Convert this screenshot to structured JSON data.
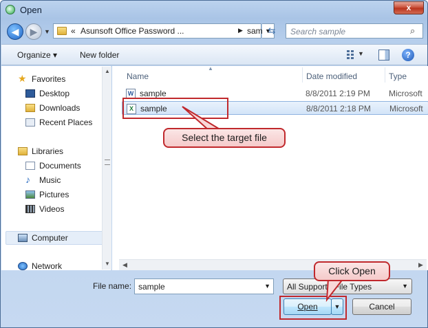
{
  "window": {
    "title": "Open",
    "close_glyph": "x"
  },
  "nav": {
    "back_glyph": "◀",
    "forward_glyph": "▶",
    "breadcrumb_chevron": "«",
    "breadcrumb": [
      "Asunsoft Office Password ...",
      "sample"
    ],
    "search_placeholder": "Search sample"
  },
  "toolbar": {
    "organize": "Organize ▾",
    "new_folder": "New folder",
    "help_glyph": "?"
  },
  "sidebar": {
    "items": [
      {
        "label": "Favorites",
        "icon": "star-icon"
      },
      {
        "label": "Desktop",
        "icon": "desktop-icon"
      },
      {
        "label": "Downloads",
        "icon": "downloads-folder-icon"
      },
      {
        "label": "Recent Places",
        "icon": "recent-places-icon"
      },
      {
        "label": "Libraries",
        "icon": "libraries-icon"
      },
      {
        "label": "Documents",
        "icon": "documents-icon"
      },
      {
        "label": "Music",
        "icon": "music-icon"
      },
      {
        "label": "Pictures",
        "icon": "pictures-icon"
      },
      {
        "label": "Videos",
        "icon": "videos-icon"
      },
      {
        "label": "Computer",
        "icon": "computer-icon"
      },
      {
        "label": "Network",
        "icon": "network-icon"
      }
    ]
  },
  "filelist": {
    "columns": [
      "Name",
      "Date modified",
      "Type"
    ],
    "rows": [
      {
        "name": "sample",
        "date": "8/8/2011 2:19 PM",
        "type": "Microsoft",
        "icon": "word-doc-icon",
        "icon_glyph": "W",
        "icon_color": "#2b579a"
      },
      {
        "name": "sample",
        "date": "8/8/2011 2:18 PM",
        "type": "Microsoft",
        "icon": "excel-doc-icon",
        "icon_glyph": "X",
        "icon_color": "#1f7a3a"
      }
    ]
  },
  "bottom": {
    "file_name_label": "File name:",
    "file_name_value": "sample",
    "file_type_value": "All Supporte  File Types",
    "open_label": "Open",
    "cancel_label": "Cancel"
  },
  "annotations": {
    "select_target": "Select the target file",
    "click_open": "Click Open",
    "color": "#c0282c"
  }
}
